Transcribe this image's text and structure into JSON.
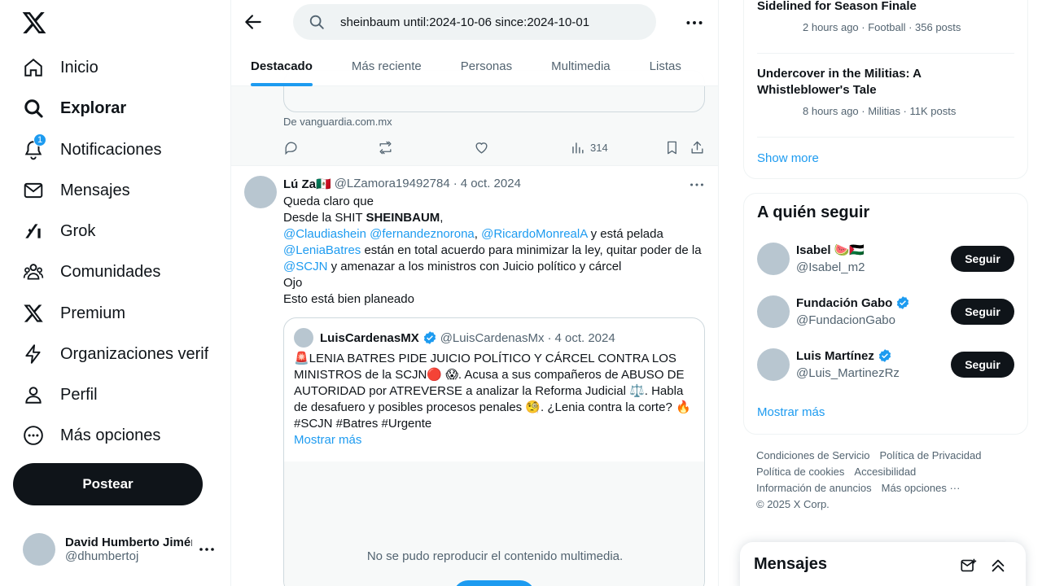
{
  "nav": {
    "items": [
      {
        "label": "Inicio",
        "icon": "home-icon"
      },
      {
        "label": "Explorar",
        "icon": "search-icon"
      },
      {
        "label": "Notificaciones",
        "icon": "bell-icon",
        "badge": "1"
      },
      {
        "label": "Mensajes",
        "icon": "mail-icon"
      },
      {
        "label": "Grok",
        "icon": "grok-icon"
      },
      {
        "label": "Comunidades",
        "icon": "communities-icon"
      },
      {
        "label": "Premium",
        "icon": "x-logo-icon"
      },
      {
        "label": "Organizaciones verificadas",
        "icon": "lightning-icon"
      },
      {
        "label": "Perfil",
        "icon": "person-icon"
      },
      {
        "label": "Más opciones",
        "icon": "more-circle-icon"
      }
    ],
    "post_button": "Postear",
    "account": {
      "name": "David Humberto Jiménez",
      "handle": "@dhumbertoj"
    }
  },
  "search": {
    "value": "sheinbaum until:2024-10-06 since:2024-10-01"
  },
  "tabs": [
    "Destacado",
    "Más reciente",
    "Personas",
    "Multimedia",
    "Listas"
  ],
  "active_tab": "Destacado",
  "prev_tweet": {
    "source": "De vanguardia.com.mx",
    "views": "314"
  },
  "tweet": {
    "name": "Lú Za🇲🇽",
    "handle": "@LZamora19492784",
    "date": "4 oct. 2024",
    "line1": "Queda claro que",
    "line2_pre": "Desde la SHIT ",
    "line2_bold": "SHEINBAUM",
    "line2_post": ",",
    "mention1": "@Claudiashein",
    "mention2": "@fernandeznorona",
    "sep_comma": ",",
    "mention3": "@RicardoMonrealA",
    "line3_post": "  y está pelada",
    "mention4": "@LeniaBatres",
    "line4_post": "  están en total acuerdo para minimizar la ley, quitar poder de la ",
    "mention5": "@SCJN",
    "line5_post": " y amenazar a los ministros con Juicio político y cárcel",
    "line6": "Ojo",
    "line7": "Esto está bien planeado"
  },
  "quote": {
    "name": "LuisCardenasMX",
    "handle": "@LuisCardenasMx",
    "date": "4 oct. 2024",
    "text": "🚨LENIA BATRES PIDE JUICIO POLÍTICO Y CÁRCEL CONTRA LOS MINISTROS de la SCJN🔴 😱. Acusa a sus compañeros de ABUSO DE AUTORIDAD por ATREVERSE a analizar la Reforma Judicial ⚖️. Habla de desafuero y posibles procesos penales 🧐. ¿Lenia contra la corte? 🔥 #SCJN #Batres #Urgente",
    "more": "Mostrar más",
    "media_error": "No se pudo reproducir el contenido multimedia."
  },
  "trends": [
    {
      "title": "Sidelined for Season Finale",
      "meta": "2 hours ago · Football · 356 posts"
    },
    {
      "title": "Undercover in the Militias: A Whistleblower's Tale",
      "meta": "8 hours ago · Militias · 11K posts"
    }
  ],
  "trends_show_more": "Show more",
  "follow": {
    "title": "A quién seguir",
    "button": "Seguir",
    "items": [
      {
        "name": "Isabel 🍉🇵🇸",
        "handle": "@Isabel_m2"
      },
      {
        "name": "Fundación Gabo",
        "handle": "@FundacionGabo"
      },
      {
        "name": "Luis Martínez",
        "handle": "@Luis_MartinezRz"
      }
    ],
    "show_more": "Mostrar más"
  },
  "footer": {
    "links": [
      "Condiciones de Servicio",
      "Política de Privacidad",
      "Política de cookies",
      "Accesibilidad",
      "Información de anuncios",
      "Más opciones ···"
    ],
    "copyright": "© 2025 X Corp."
  },
  "messages": {
    "title": "Mensajes"
  },
  "colors": {
    "accent": "#1d9bf0",
    "text": "#0f1419",
    "muted": "#536471"
  }
}
